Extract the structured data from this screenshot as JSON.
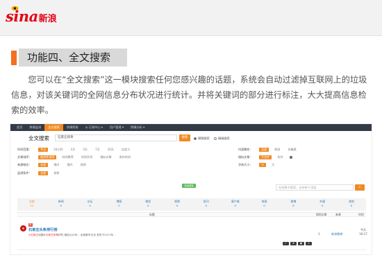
{
  "brand": {
    "latin": "sina",
    "cjk": "新浪",
    "color": "#e60012"
  },
  "section": {
    "title": "功能四、全文搜索",
    "accent": "#f36f21"
  },
  "intro": "您可以在“全文搜索”这一模块搜索任何您感兴趣的话题，系统会自动过滤掉互联网上的垃圾信息，对该关键词的全网信息分布状况进行统计。并将关键词的部分进行标注，大大提高信息检索的效率。",
  "app": {
    "nav": [
      "首页",
      "舆情监测",
      "全文搜索",
      "舆情简报",
      "◎ 订阅中心 ▾",
      "用户管理 ▾",
      "舆情分析 ▾"
    ],
    "search": {
      "title": "全文搜索",
      "query": "石家庄排骨",
      "button": "搜索",
      "modes": [
        "模糊搜索",
        "精确搜索"
      ]
    },
    "filters": {
      "time": {
        "label": "时间范围：",
        "options": [
          "今日",
          "24小时",
          "2天",
          "3天",
          "7天",
          "10天",
          "自定义"
        ]
      },
      "sort": {
        "label": "文章排序：",
        "options": [
          "相关性排序",
          "时间降序",
          "时间升序",
          "相似文章",
          "发布时间"
        ]
      },
      "domain": {
        "label": "来源域名：",
        "options": [
          "全部",
          "境内",
          "境外",
          "其他"
        ]
      },
      "condition": {
        "label": "监测条件：",
        "options": [
          "全部",
          "其他"
        ]
      },
      "attribute": {
        "label": "内容属性：",
        "options": [
          "全部",
          "原创",
          "非敏感"
        ]
      },
      "similar": {
        "label": "相似文章：",
        "options": [
          "不合并",
          "合并"
        ]
      },
      "wordsize": {
        "label": "字体大小：",
        "options": [
          "小",
          "大"
        ]
      }
    },
    "advanced_button": "高级搜索",
    "inner_search_placeholder": "在结果中搜索，支持单个词组",
    "inner_search_icon": "search-icon",
    "stats": [
      {
        "name": "全部",
        "count": "12"
      },
      {
        "name": "新闻",
        "count": "0"
      },
      {
        "name": "论坛",
        "count": "4"
      },
      {
        "name": "博客",
        "count": "2"
      },
      {
        "name": "微信",
        "count": "0"
      },
      {
        "name": "视频",
        "count": "0"
      },
      {
        "name": "报刊",
        "count": "0"
      },
      {
        "name": "客户端",
        "count": "0"
      },
      {
        "name": "电视",
        "count": "0"
      },
      {
        "name": "微博",
        "count": "0"
      },
      {
        "name": "外媒",
        "count": "0"
      },
      {
        "name": "其他",
        "count": "0"
      }
    ],
    "table": {
      "headers": {
        "title": "标题",
        "count": "相同文章",
        "source": "来源",
        "time": "时间"
      },
      "row": {
        "badge": "原",
        "title": "石家庄头条排行榜",
        "snippet_hl1": "#石家庄",
        "snippet_mid1": "话题#",
        "snippet_hl2": "石家庄排骨",
        "snippet_rest": "好吃 微信公众号:...全家都市文化 发布于2017年...",
        "count": "1",
        "source": "新浪微博",
        "time_line1": "今天",
        "time_line2": "16:17",
        "actions": [
          "✓",
          "★",
          "▣",
          "⇩"
        ]
      }
    },
    "accent_color": "#f08a24",
    "link_color": "#2a7ab8",
    "nav_bg": "#333a47"
  }
}
